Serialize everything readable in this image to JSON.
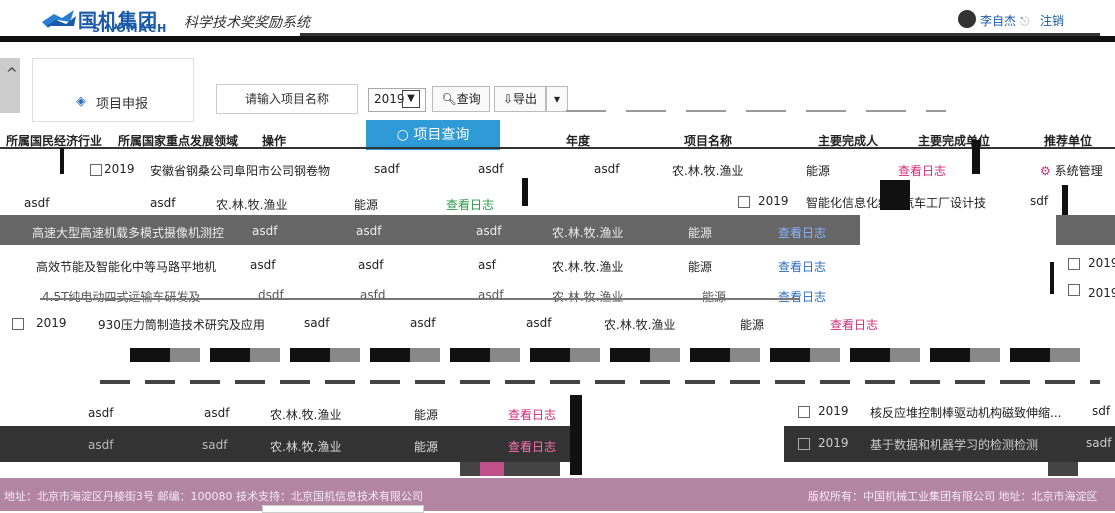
{
  "header": {
    "brand_cn": "国机集团",
    "brand_en": "SINOMACH",
    "system_title": "科学技术奖奖励系统",
    "user_name": "李自杰",
    "logout_label": "注销"
  },
  "sidebar": {
    "nav_label": "项目申报"
  },
  "toolbar": {
    "search_placeholder": "请输入项目名称",
    "year_value": "2019",
    "query_label": "查询",
    "export_label": "导出",
    "project_query_label": "项目查询"
  },
  "table": {
    "headers": [
      "所属国民经济行业",
      "所属国家重点发展领域",
      "操作",
      "年度",
      "项目名称",
      "主要完成人",
      "主要完成单位",
      "推荐单位"
    ],
    "rows": [
      {
        "year": "2019",
        "name": "安徽省钢桑公司阜阳市公司钢卷物",
        "c1": "sadf",
        "c2": "asdf",
        "c3": "asdf",
        "industry": "农.林.牧.渔业",
        "field": "能源",
        "op": "查看日志",
        "extra": "系统管理"
      },
      {
        "year": "",
        "name": "",
        "c1": "asdf",
        "c2": "asdf",
        "c3": "",
        "industry": "农.林.牧.渔业",
        "field": "能源",
        "op": "查看日志",
        "extra": ""
      },
      {
        "year": "2019",
        "name": "智能化信息化绿色汽车工厂设计技",
        "c1": "sdf",
        "c2": "",
        "c3": "",
        "industry": "",
        "field": "",
        "op": "",
        "extra": ""
      },
      {
        "year": "",
        "name": "高速大型高速机载多模式摄像机测控",
        "c1": "asdf",
        "c2": "asdf",
        "c3": "asdf",
        "industry": "农.林.牧.渔业",
        "field": "能源",
        "op": "查看日志",
        "extra": ""
      },
      {
        "year": "",
        "name": "高效节能及智能化中等马路平地机",
        "c1": "asdf",
        "c2": "asdf",
        "c3": "asf",
        "industry": "农.林.牧.渔业",
        "field": "能源",
        "op": "查看日志",
        "extra": "2019"
      },
      {
        "year": "",
        "name": "4.5T纯电动四式远输车研发及",
        "c1": "dsdf",
        "c2": "asfd",
        "c3": "asdf",
        "industry": "农.林.牧.渔业",
        "field": "能源",
        "op": "查看日志",
        "extra": "2019"
      },
      {
        "year": "2019",
        "name": "930压力筒制造技术研究及应用",
        "c1": "sadf",
        "c2": "asdf",
        "c3": "asdf",
        "industry": "农.林.牧.渔业",
        "field": "能源",
        "op": "查看日志",
        "extra": ""
      },
      {
        "year": "",
        "name": "",
        "c1": "asdf",
        "c2": "asdf",
        "c3": "",
        "industry": "农.林.牧.渔业",
        "field": "能源",
        "op": "查看日志",
        "extra": ""
      },
      {
        "year": "2019",
        "name": "核反应堆控制棒驱动机构磁致伸缩...",
        "c1": "sdf",
        "c2": "",
        "c3": "",
        "industry": "",
        "field": "",
        "op": "",
        "extra": ""
      },
      {
        "year": "",
        "name": "",
        "c1": "asdf",
        "c2": "sadf",
        "c3": "",
        "industry": "农.林.牧.渔业",
        "field": "能源",
        "op": "查看日志",
        "extra": ""
      },
      {
        "year": "2019",
        "name": "基于数据和机器学习的检测检测",
        "c1": "sadf",
        "c2": "",
        "c3": "",
        "industry": "",
        "field": "",
        "op": "",
        "extra": ""
      }
    ]
  },
  "footer": {
    "left": "地址：北京市海淀区丹棱街3号 邮编：100080 技术支持：北京国机信息技术有限公司",
    "right": "版权所有：中国机械工业集团有限公司 地址：北京市海淀区"
  },
  "colors": {
    "brand": "#1a5aa8",
    "accent": "#2e9ad6",
    "link": "#d42c7a",
    "footer": "#b285a3"
  }
}
